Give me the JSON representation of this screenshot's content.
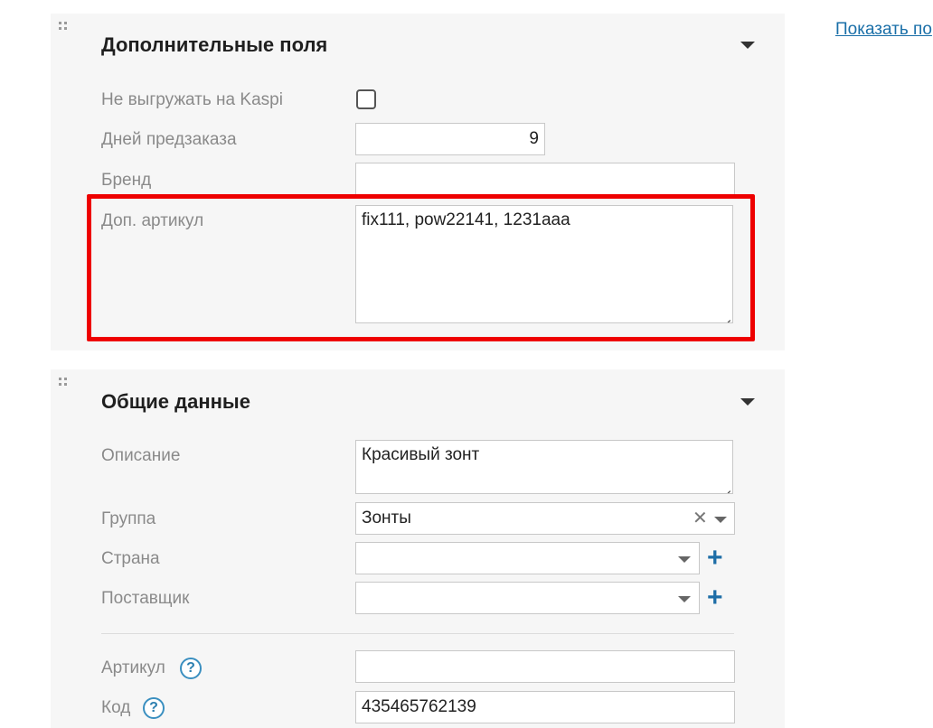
{
  "extra_panel": {
    "title": "Дополнительные поля",
    "fields": {
      "no_export_kaspi": {
        "label": "Не выгружать на Kaspi",
        "checked": false
      },
      "preorder_days": {
        "label": "Дней предзаказа",
        "value": "9"
      },
      "brand": {
        "label": "Бренд",
        "value": ""
      },
      "extra_sku": {
        "label": "Доп. артикул",
        "value": "fix111, pow22141, 1231aaa"
      }
    }
  },
  "general_panel": {
    "title": "Общие данные",
    "fields": {
      "description": {
        "label": "Описание",
        "value": "Красивый зонт"
      },
      "group": {
        "label": "Группа",
        "value": "Зонты"
      },
      "country": {
        "label": "Страна",
        "value": ""
      },
      "supplier": {
        "label": "Поставщик",
        "value": ""
      },
      "sku": {
        "label": "Артикул",
        "value": ""
      },
      "code": {
        "label": "Код",
        "value": "435465762139"
      }
    },
    "help_glyph": "?",
    "clear_glyph": "✕",
    "add_glyph": "+"
  },
  "show_link": {
    "label": "Показать по"
  },
  "colors": {
    "accent_link": "#1a6fa8",
    "highlight": "#ee0000",
    "panel_bg": "#f6f6f6"
  }
}
